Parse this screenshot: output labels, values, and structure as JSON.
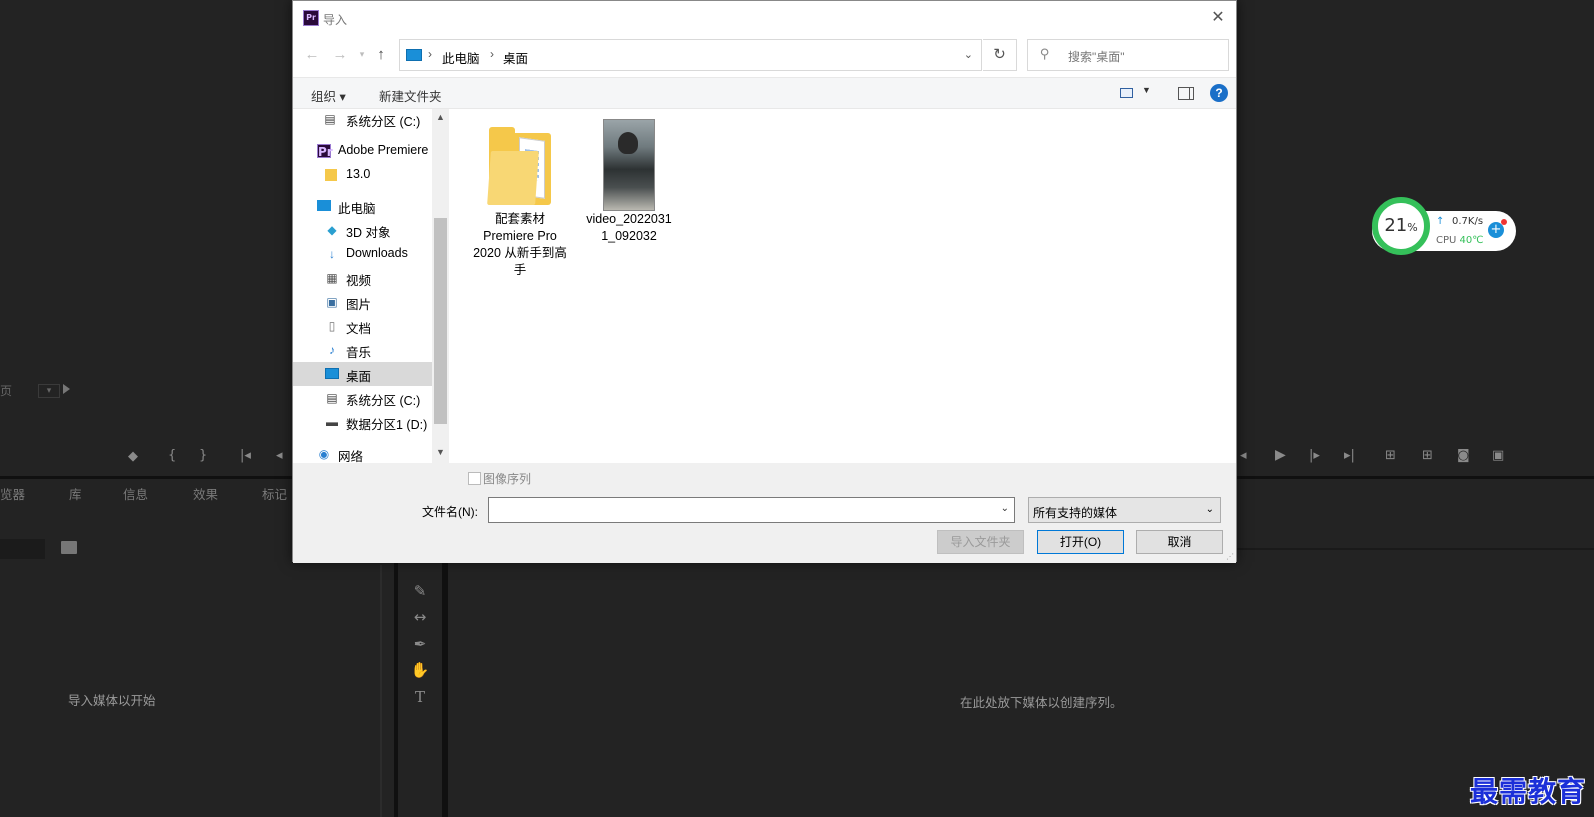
{
  "background": {
    "tabs": [
      "览器",
      "库",
      "信息",
      "效果",
      "标记"
    ],
    "page_label": "页",
    "project_empty": "导入媒体以开始",
    "timeline_empty": "在此处放下媒体以创建序列。"
  },
  "dialog": {
    "logo": "Pr",
    "title": "导入",
    "address": {
      "segments": [
        "此电脑",
        "桌面"
      ]
    },
    "search_placeholder": "搜索\"桌面\"",
    "toolbar": {
      "organize": "组织 ▾",
      "new_folder": "新建文件夹"
    },
    "nav_items": [
      {
        "label": "系统分区 (C:)",
        "icon": "drive-icon"
      },
      {
        "label": "Adobe Premiere",
        "icon": "premiere-icon"
      },
      {
        "label": "13.0",
        "icon": "folder-icon"
      },
      {
        "label": "此电脑",
        "icon": "computer-icon"
      },
      {
        "label": "3D 对象",
        "icon": "3d-objects-icon"
      },
      {
        "label": "Downloads",
        "icon": "download-icon"
      },
      {
        "label": "视频",
        "icon": "video-icon"
      },
      {
        "label": "图片",
        "icon": "pictures-icon"
      },
      {
        "label": "文档",
        "icon": "documents-icon"
      },
      {
        "label": "音乐",
        "icon": "music-icon"
      },
      {
        "label": "桌面",
        "icon": "desktop-icon",
        "selected": true
      },
      {
        "label": "系统分区 (C:)",
        "icon": "drive-icon"
      },
      {
        "label": "数据分区1 (D:)",
        "icon": "drive-icon"
      },
      {
        "label": "网络",
        "icon": "network-icon"
      }
    ],
    "files": [
      {
        "name_lines": [
          "配套素材",
          "Premiere Pro",
          "2020 从新手到高",
          "手"
        ],
        "type": "folder"
      },
      {
        "name_lines": [
          "video_2022031",
          "1_092032"
        ],
        "type": "video"
      }
    ],
    "image_sequence_label": "图像序列",
    "filename_label": "文件名(N):",
    "filename_value": "",
    "file_type": "所有支持的媒体",
    "buttons": {
      "import_folder": "导入文件夹",
      "open": "打开(O)",
      "cancel": "取消"
    }
  },
  "cpu_widget": {
    "percent": "21",
    "percent_sign": "%",
    "net_speed": "0.7K/s",
    "cpu_label": "CPU",
    "temp": "40℃"
  },
  "watermark": "最需教育",
  "colors": {
    "accent": "#0078d7",
    "cpu_green": "#35c05a",
    "watermark_blue": "#1b2fd8"
  }
}
